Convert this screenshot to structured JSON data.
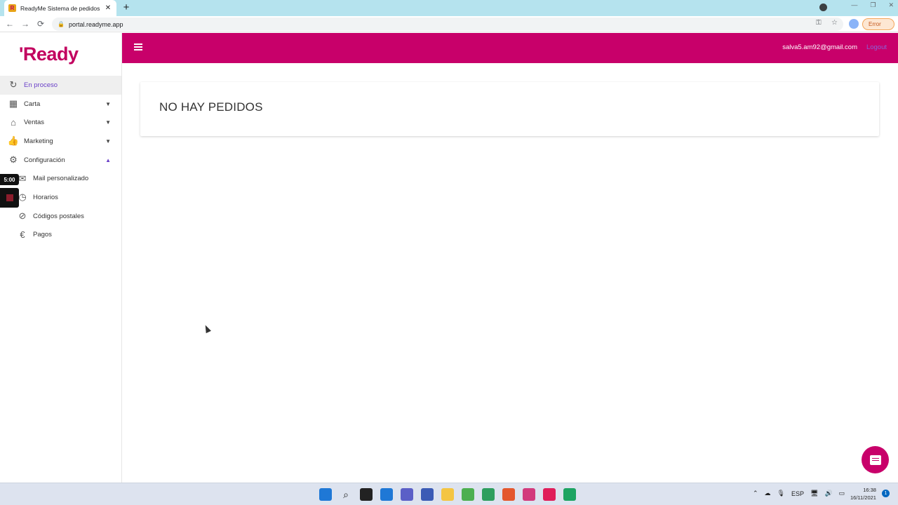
{
  "browser": {
    "tab_title": "ReadyMe Sistema de pedidos",
    "tab_favicon": "R",
    "close_glyph": "✕",
    "new_tab_glyph": "+",
    "url": "portal.readyme.app",
    "error_label": "Error",
    "icons": {
      "back": "←",
      "forward": "→",
      "reload": "⟳",
      "lock": "🔒",
      "key": "⚿",
      "star": "☆",
      "minimize": "—",
      "restore": "❐",
      "close": "✕"
    }
  },
  "app": {
    "logo": "'Ready",
    "brand_color": "#c8006a",
    "header": {
      "user_email": "salva5.am92@gmail.com",
      "logout_label": "Logout"
    },
    "sidebar": {
      "items": [
        {
          "label": "En proceso",
          "icon": "↻",
          "active": true
        },
        {
          "label": "Carta",
          "icon": "▦",
          "caret": "▼"
        },
        {
          "label": "Ventas",
          "icon": "⌂",
          "caret": "▼"
        },
        {
          "label": "Marketing",
          "icon": "👍",
          "caret": "▼"
        },
        {
          "label": "Configuración",
          "icon": "⚙",
          "caret": "▲"
        },
        {
          "label": "Mail personalizado",
          "icon": "✉"
        },
        {
          "label": "Horarios",
          "icon": "◷"
        },
        {
          "label": "Códigos postales",
          "icon": "⊘"
        },
        {
          "label": "Pagos",
          "icon": "€"
        }
      ]
    },
    "main": {
      "empty_message": "NO HAY PEDIDOS"
    }
  },
  "overlay": {
    "timer": "5:00"
  },
  "taskbar": {
    "language": "ESP",
    "time": "16:38",
    "date": "16/11/2021",
    "notifications": "1"
  }
}
